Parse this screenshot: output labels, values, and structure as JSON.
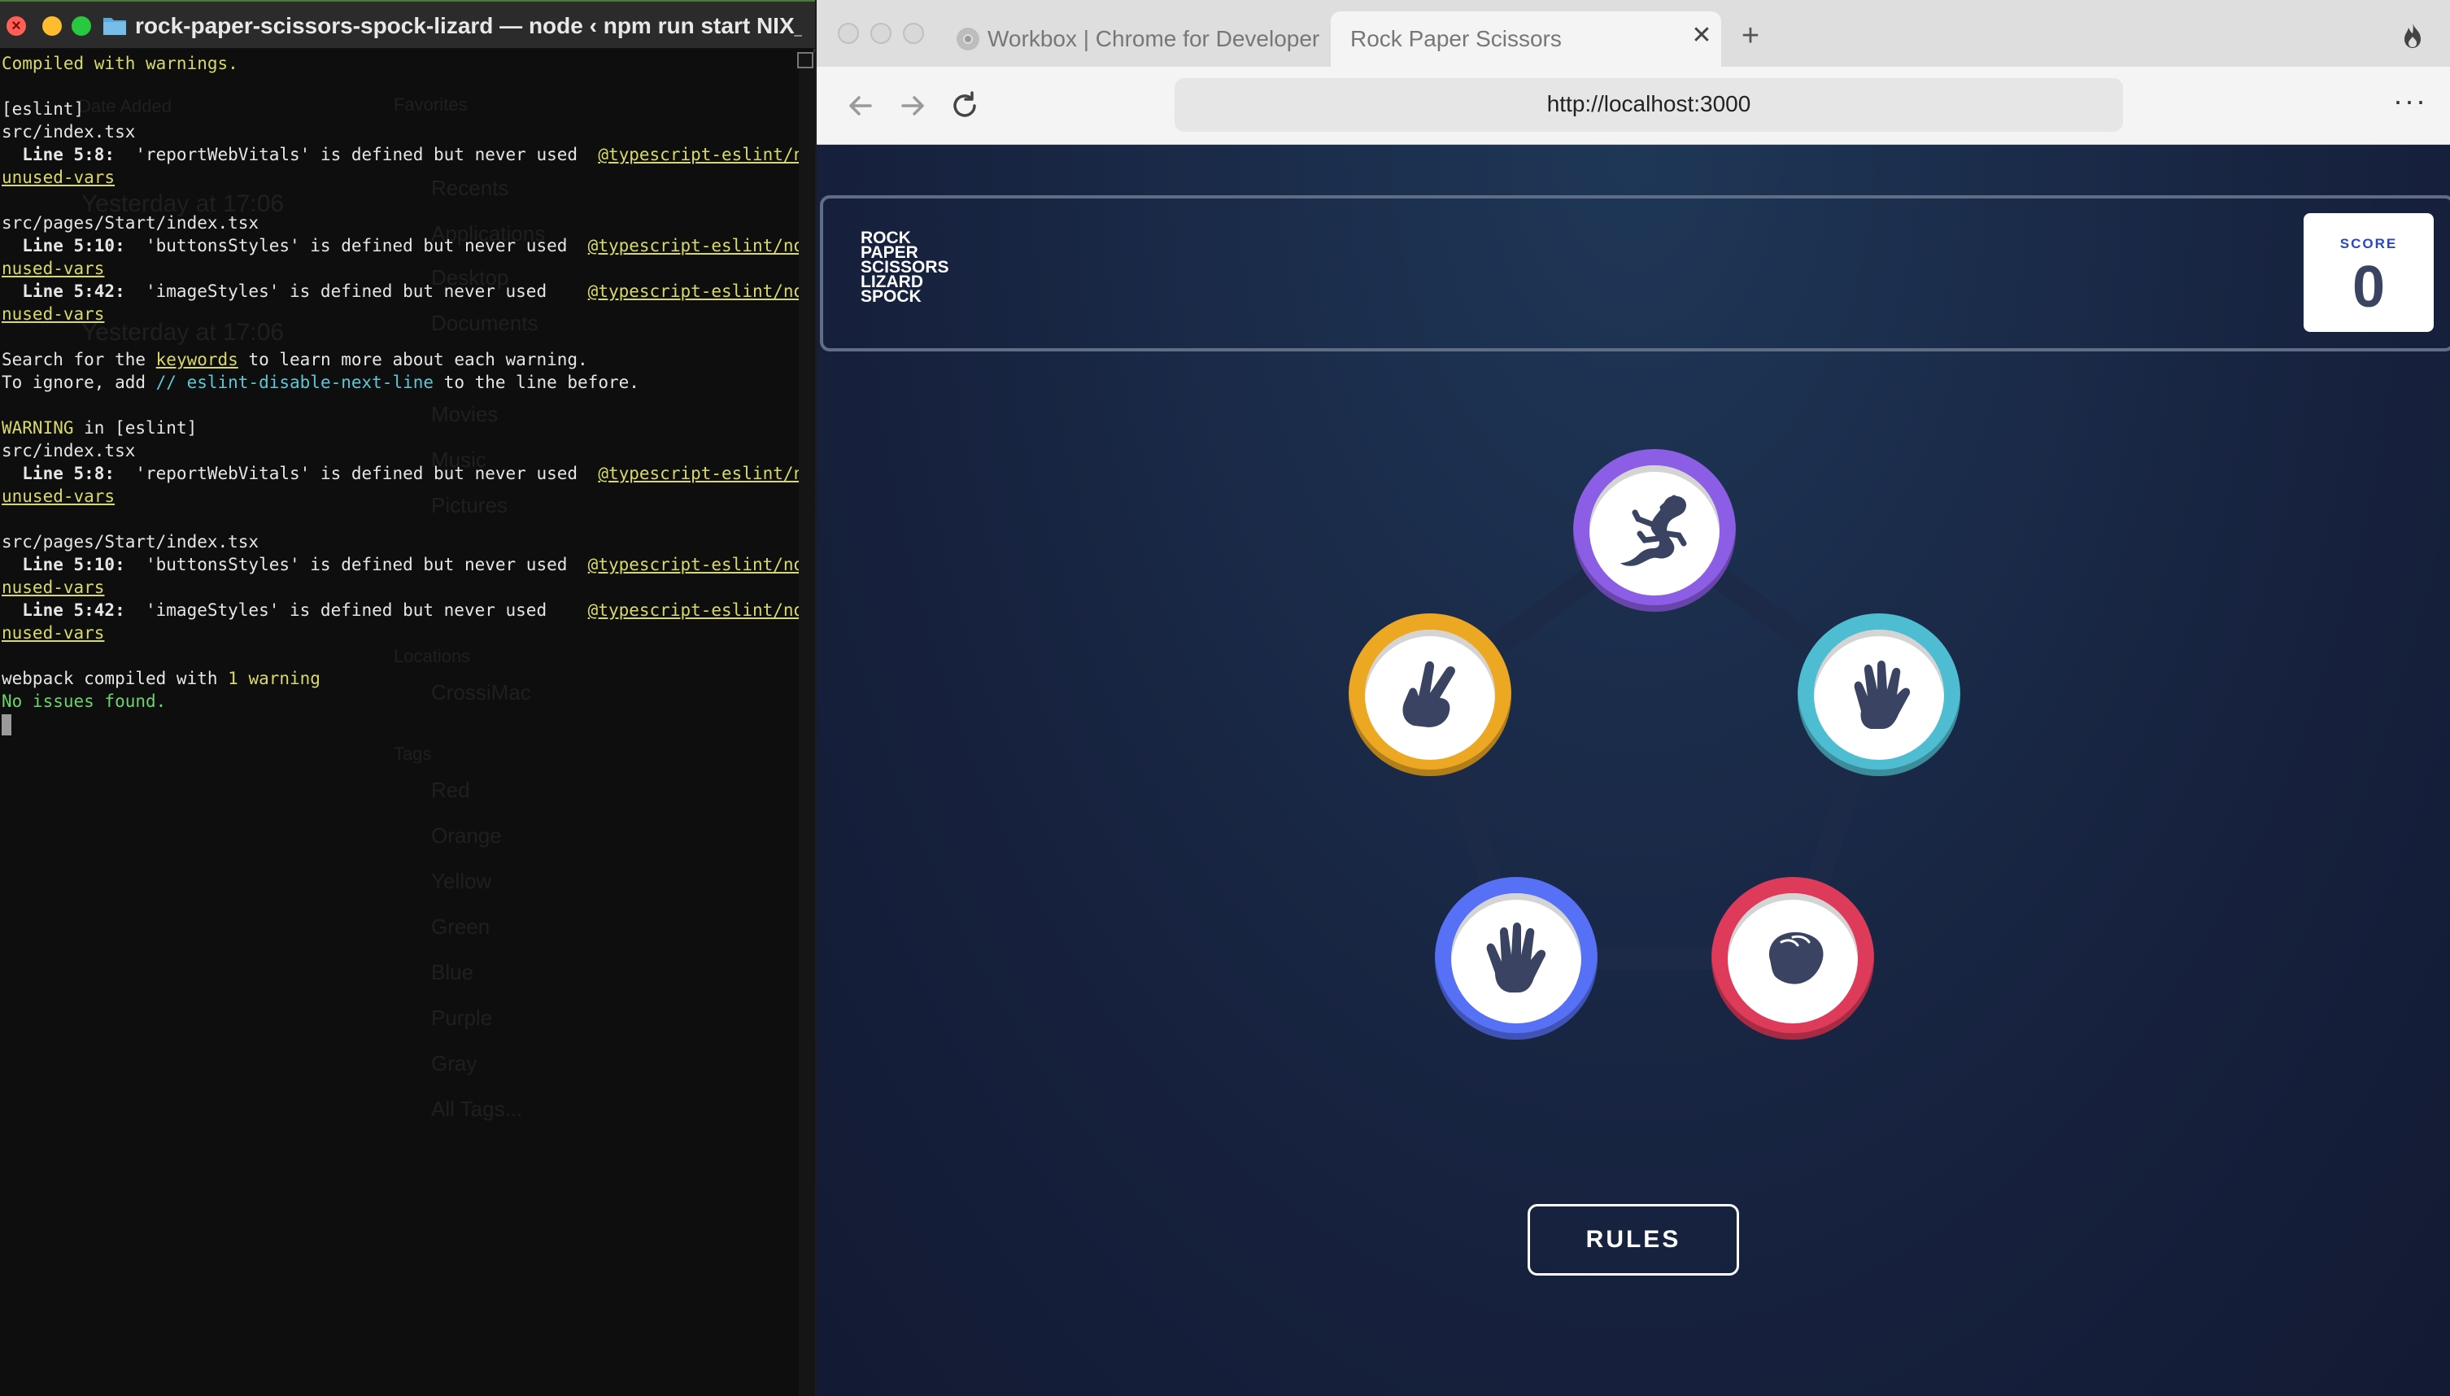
{
  "terminal": {
    "title": "rock-paper-scissors-spock-lizard — node ‹ npm run start NIX_...",
    "lines": [
      {
        "parts": [
          {
            "t": "Compiled with warnings.",
            "c": "yel"
          }
        ]
      },
      {
        "parts": [
          {
            "t": "",
            "c": ""
          }
        ]
      },
      {
        "parts": [
          {
            "t": "[eslint]",
            "c": ""
          }
        ]
      },
      {
        "parts": [
          {
            "t": "src/index.tsx",
            "c": ""
          }
        ]
      },
      {
        "parts": [
          {
            "t": "  Line 5:8:",
            "c": "bold"
          },
          {
            "t": "  'reportWebVitals' is defined but never used  ",
            "c": ""
          },
          {
            "t": "@typescript-eslint/no-",
            "c": "ul"
          }
        ]
      },
      {
        "parts": [
          {
            "t": "unused-vars",
            "c": "ul"
          }
        ]
      },
      {
        "parts": [
          {
            "t": "",
            "c": ""
          }
        ]
      },
      {
        "parts": [
          {
            "t": "src/pages/Start/index.tsx",
            "c": ""
          }
        ]
      },
      {
        "parts": [
          {
            "t": "  Line 5:10:",
            "c": "bold"
          },
          {
            "t": "  'buttonsStyles' is defined but never used  ",
            "c": ""
          },
          {
            "t": "@typescript-eslint/no-u",
            "c": "ul"
          }
        ]
      },
      {
        "parts": [
          {
            "t": "nused-vars",
            "c": "ul"
          }
        ]
      },
      {
        "parts": [
          {
            "t": "  Line 5:42:",
            "c": "bold"
          },
          {
            "t": "  'imageStyles' is defined but never used    ",
            "c": ""
          },
          {
            "t": "@typescript-eslint/no-u",
            "c": "ul"
          }
        ]
      },
      {
        "parts": [
          {
            "t": "nused-vars",
            "c": "ul"
          }
        ]
      },
      {
        "parts": [
          {
            "t": "",
            "c": ""
          }
        ]
      },
      {
        "parts": [
          {
            "t": "Search for the ",
            "c": ""
          },
          {
            "t": "keywords",
            "c": "ul"
          },
          {
            "t": " to learn more about each warning.",
            "c": ""
          }
        ]
      },
      {
        "parts": [
          {
            "t": "To ignore, add ",
            "c": ""
          },
          {
            "t": "// eslint-disable-next-line",
            "c": "cy"
          },
          {
            "t": " to the line before.",
            "c": ""
          }
        ]
      },
      {
        "parts": [
          {
            "t": "",
            "c": ""
          }
        ]
      },
      {
        "parts": [
          {
            "t": "WARNING",
            "c": "yel"
          },
          {
            "t": " in [eslint]",
            "c": ""
          }
        ]
      },
      {
        "parts": [
          {
            "t": "src/index.tsx",
            "c": ""
          }
        ]
      },
      {
        "parts": [
          {
            "t": "  Line 5:8:",
            "c": "bold"
          },
          {
            "t": "  'reportWebVitals' is defined but never used  ",
            "c": ""
          },
          {
            "t": "@typescript-eslint/no-",
            "c": "ul"
          }
        ]
      },
      {
        "parts": [
          {
            "t": "unused-vars",
            "c": "ul"
          }
        ]
      },
      {
        "parts": [
          {
            "t": "",
            "c": ""
          }
        ]
      },
      {
        "parts": [
          {
            "t": "src/pages/Start/index.tsx",
            "c": ""
          }
        ]
      },
      {
        "parts": [
          {
            "t": "  Line 5:10:",
            "c": "bold"
          },
          {
            "t": "  'buttonsStyles' is defined but never used  ",
            "c": ""
          },
          {
            "t": "@typescript-eslint/no-u",
            "c": "ul"
          }
        ]
      },
      {
        "parts": [
          {
            "t": "nused-vars",
            "c": "ul"
          }
        ]
      },
      {
        "parts": [
          {
            "t": "  Line 5:42:",
            "c": "bold"
          },
          {
            "t": "  'imageStyles' is defined but never used    ",
            "c": ""
          },
          {
            "t": "@typescript-eslint/no-u",
            "c": "ul"
          }
        ]
      },
      {
        "parts": [
          {
            "t": "nused-vars",
            "c": "ul"
          }
        ]
      },
      {
        "parts": [
          {
            "t": "",
            "c": ""
          }
        ]
      },
      {
        "parts": [
          {
            "t": "webpack compiled with ",
            "c": ""
          },
          {
            "t": "1 warning",
            "c": "yel"
          }
        ]
      },
      {
        "parts": [
          {
            "t": "No issues found.",
            "c": "gr"
          }
        ]
      }
    ]
  },
  "finder_ghost": {
    "date_added": "Date Added",
    "yesterday_1": "Yesterday at 17:06",
    "yesterday_2": "Yesterday at 17:06",
    "favorites": "Favorites",
    "recents": "Recents",
    "applications": "Applications",
    "desktop": "Desktop",
    "documents": "Documents",
    "movies": "Movies",
    "music": "Music",
    "pictures": "Pictures",
    "locations": "Locations",
    "crossimac": "CrossiMac",
    "tags": "Tags",
    "red": "Red",
    "orange": "Orange",
    "yellow": "Yellow",
    "green": "Green",
    "blue": "Blue",
    "purple": "Purple",
    "gray": "Gray",
    "all_tags": "All Tags..."
  },
  "browser": {
    "tabs": [
      {
        "label": "Workbox  |  Chrome for Developer",
        "active": false
      },
      {
        "label": "Rock Paper Scissors",
        "active": true
      }
    ],
    "new_tab": "+",
    "close_tab": "✕",
    "url": "http://localhost:3000",
    "menu": "···"
  },
  "game": {
    "logo_lines": [
      "ROCK",
      "PAPER",
      "SCISSORS",
      "LIZARD",
      "SPOCK"
    ],
    "score_label": "SCORE",
    "score_value": "0",
    "choices": [
      {
        "id": "lizard",
        "color": "#8c5de5"
      },
      {
        "id": "scissors",
        "color": "#eca822"
      },
      {
        "id": "spock",
        "color": "#4fbdd1"
      },
      {
        "id": "paper",
        "color": "#5671f5"
      },
      {
        "id": "rock",
        "color": "#de3a5a"
      }
    ],
    "rules_label": "RULES"
  },
  "colors": {
    "page_bg": "#16213d",
    "header_border": "#606e85",
    "score_label": "#2a46c0",
    "score_value": "#3b4363",
    "icon_fill": "#3b4363"
  }
}
